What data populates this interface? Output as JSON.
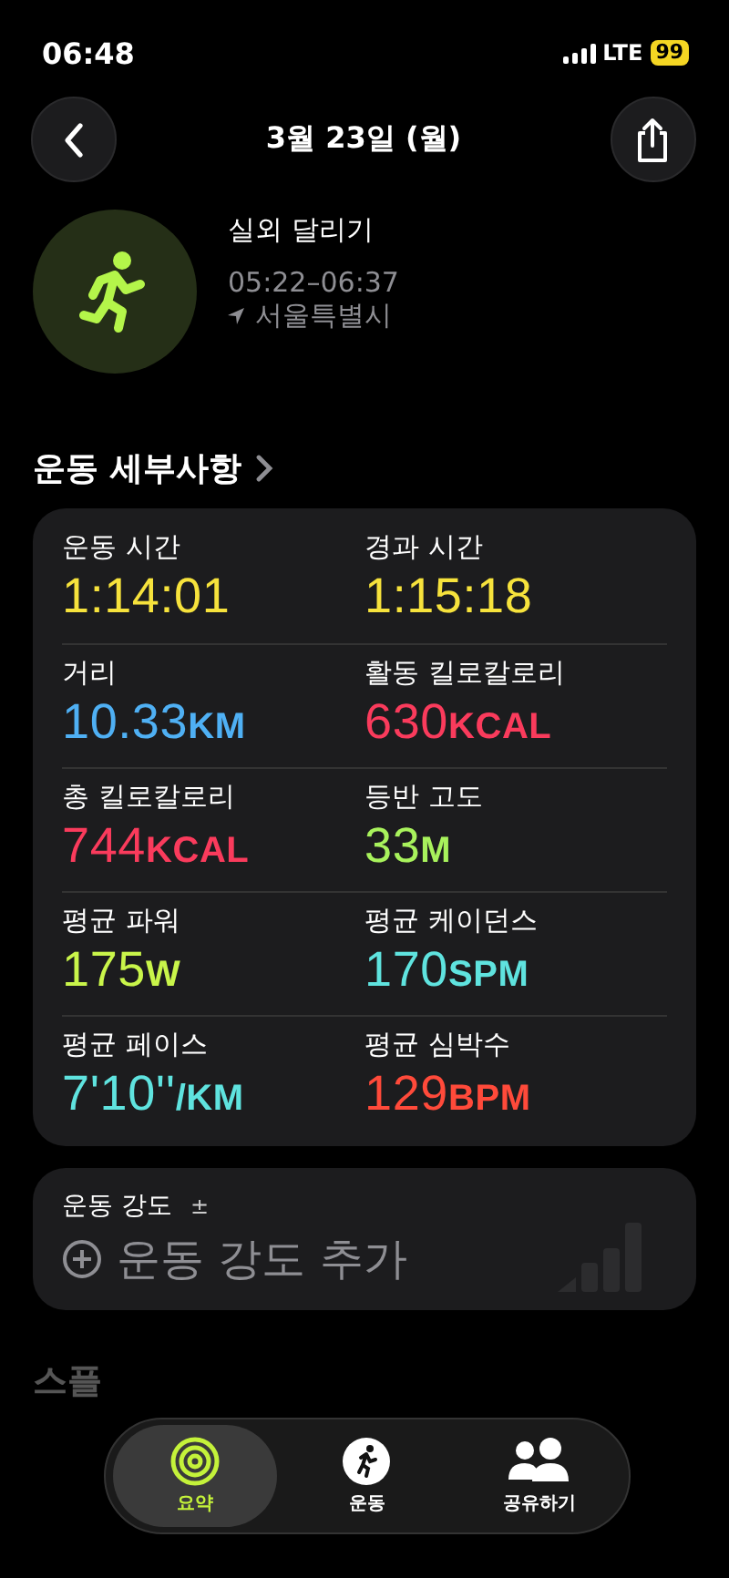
{
  "status_bar": {
    "time": "06:48",
    "network": "LTE",
    "battery": "99"
  },
  "header": {
    "title": "3월 23일 (월)"
  },
  "workout": {
    "name": "실외 달리기",
    "time_range": "05:22–06:37",
    "location": "서울특별시"
  },
  "details": {
    "heading": "운동 세부사항",
    "metrics": [
      {
        "label": "운동 시간",
        "value": "1:14:01",
        "color": "#f6e23c"
      },
      {
        "label": "경과 시간",
        "value": "1:15:18",
        "color": "#f6e23c"
      },
      {
        "label": "거리",
        "value": "10.33",
        "unit": "KM",
        "color": "#4fb0f4"
      },
      {
        "label": "활동 킬로칼로리",
        "value": "630",
        "unit": "KCAL",
        "color": "#fa3b5c"
      },
      {
        "label": "총 킬로칼로리",
        "value": "744",
        "unit": "KCAL",
        "color": "#fa3b5c"
      },
      {
        "label": "등반 고도",
        "value": "33",
        "unit": "M",
        "color": "#a8f25c"
      },
      {
        "label": "평균 파워",
        "value": "175",
        "unit": "W",
        "color": "#c9f54a"
      },
      {
        "label": "평균 케이던스",
        "value": "170",
        "unit": "SPM",
        "color": "#5fe3df"
      },
      {
        "label": "평균 페이스",
        "value": "7'10''",
        "unit": "/KM",
        "color": "#5fe3df"
      },
      {
        "label": "평균 심박수",
        "value": "129",
        "unit": "BPM",
        "color": "#ff4a3a"
      }
    ]
  },
  "intensity": {
    "label": "운동 강도",
    "label_mark": "±",
    "action": "운동 강도 추가"
  },
  "next_heading": "스플",
  "tab_bar": [
    {
      "label": "요약",
      "kind": "rings",
      "selected": true
    },
    {
      "label": "운동",
      "kind": "runner",
      "selected": false
    },
    {
      "label": "공유하기",
      "kind": "people",
      "selected": false
    }
  ]
}
